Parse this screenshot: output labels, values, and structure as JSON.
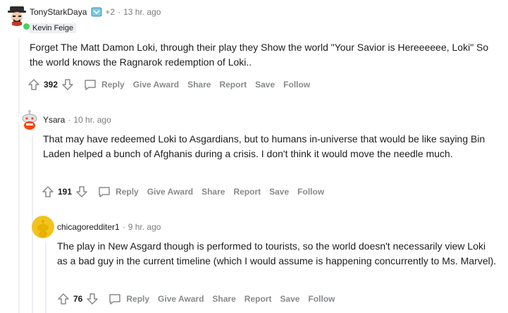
{
  "comments": [
    {
      "username": "TonyStarkDaya",
      "award_count": "+2",
      "time": "13 hr. ago",
      "flair": "Kevin Feige",
      "body": "Forget The Matt Damon Loki, through their play they Show the world \"Your Savior is Hereeeeee, Loki\" So the world knows the Ragnarok redemption of Loki..",
      "score": "392"
    },
    {
      "username": "Ysara",
      "time": "10 hr. ago",
      "body": "That may have redeemed Loki to Asgardians, but to humans in-universe that would be like saying Bin Laden helped a bunch of Afghanis during a crisis. I don't think it would move the needle much.",
      "score": "191"
    },
    {
      "username": "chicagoredditer1",
      "time": "9 hr. ago",
      "body": "The play in New Asgard though is performed to tourists, so the world doesn't necessarily view Loki as a bad guy in the current timeline (which I would assume is happening concurrently to Ms. Marvel).",
      "score": "76"
    }
  ],
  "actions": {
    "reply": "Reply",
    "give_award": "Give Award",
    "share": "Share",
    "report": "Report",
    "save": "Save",
    "follow": "Follow"
  },
  "separator": "·",
  "colors": {
    "text": "#1c1c1c",
    "muted": "#878a8c",
    "thread_line": "#edeff1",
    "online": "#46d160"
  }
}
